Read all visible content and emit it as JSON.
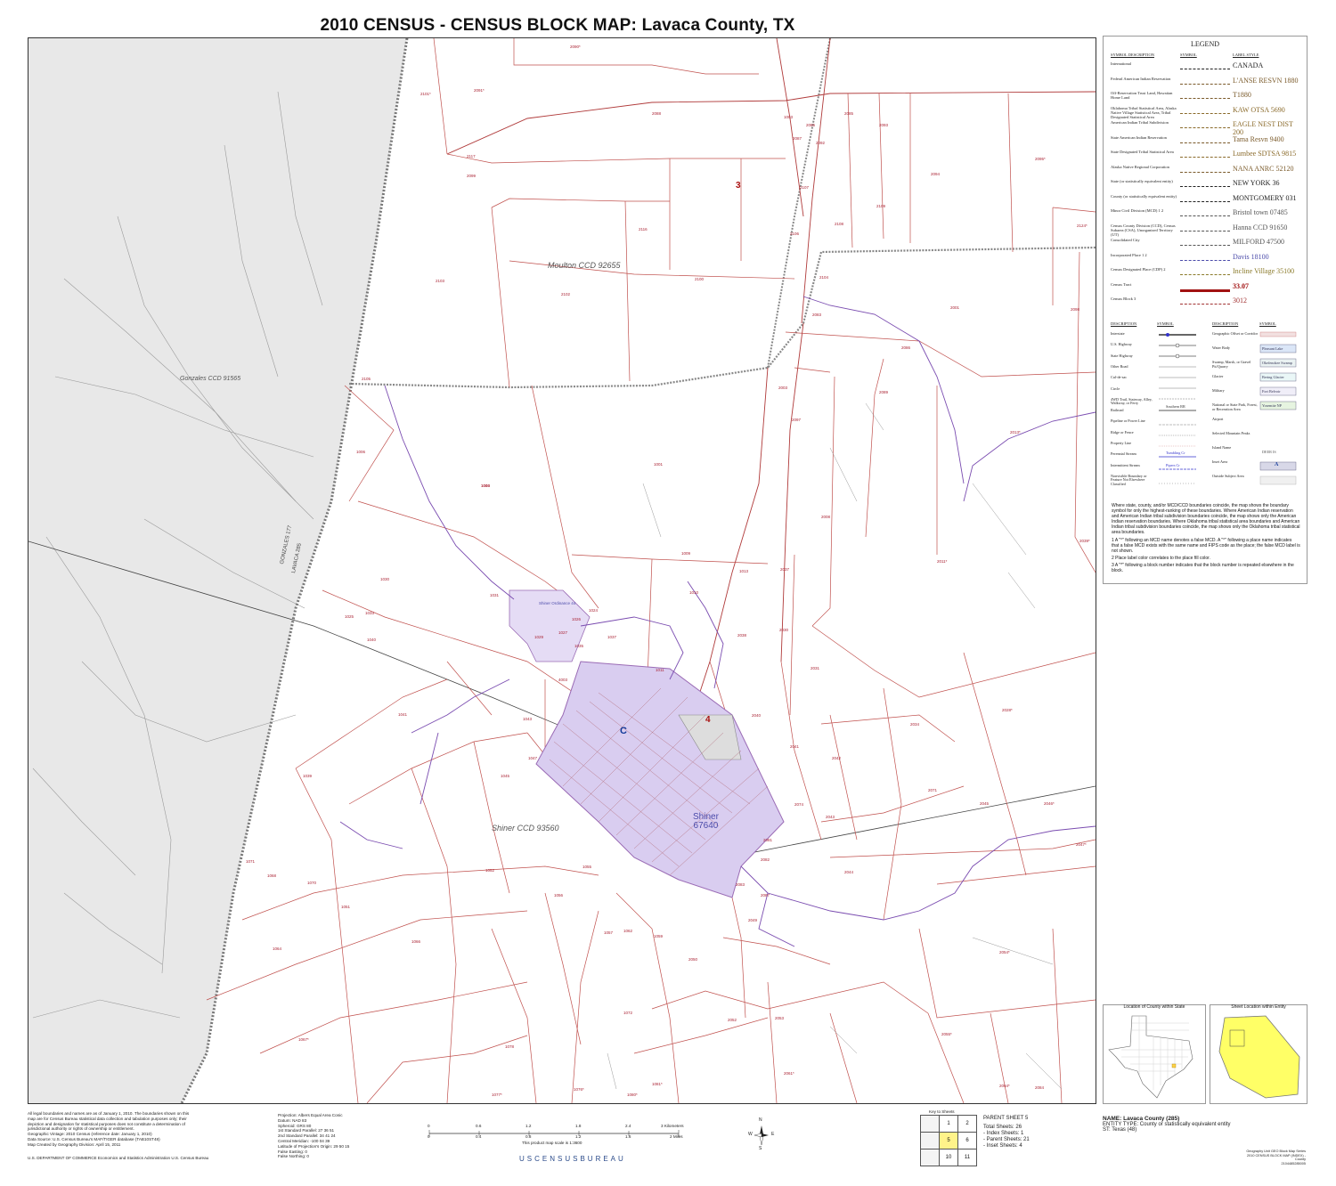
{
  "title": "2010 CENSUS - CENSUS BLOCK MAP:  Lavaca County, TX",
  "map": {
    "ccd_labels": [
      "Moulton CCD 92655",
      "Gonzales CCD 91565",
      "Shiner CCD 93560"
    ],
    "county_line_labels": [
      "GONZALES 177",
      "LAVACA 285"
    ],
    "tract_labels": [
      "3",
      "4"
    ],
    "vtd_label": "C",
    "place_label": [
      "Shiner",
      "67640"
    ],
    "block_labels": [
      "2090*",
      "2101*",
      "2091*",
      "2117",
      "2099",
      "2102",
      "2100",
      "2103",
      "2116",
      "2105",
      "2087",
      "2085",
      "2088",
      "2086",
      "2092",
      "2093",
      "2095*",
      "2094",
      "2107",
      "2106",
      "2109",
      "2108",
      "2104",
      "2124*",
      "2001",
      "2083",
      "2086",
      "2089",
      "2013*",
      "2097",
      "2098",
      "2003",
      "1001",
      "1003",
      "1006",
      "1013",
      "2037",
      "2008",
      "2011*",
      "2039*",
      "1031",
      "1030",
      "1025",
      "1027",
      "1026",
      "1024",
      "1029",
      "1035",
      "1037",
      "1009",
      "1010",
      "2038",
      "2030",
      "2031",
      "1040",
      "1041",
      "1043",
      "4003",
      "1011",
      "1033",
      "1039",
      "1045",
      "1047",
      "2040",
      "2041",
      "2042",
      "2034",
      "2028*",
      "2044",
      "2045",
      "2046*",
      "2047*",
      "2043",
      "2071",
      "2074",
      "2081",
      "2082",
      "1071",
      "1068",
      "1070",
      "1051",
      "1052",
      "1055",
      "1056",
      "1057",
      "1059",
      "1062",
      "1066",
      "1064",
      "1072",
      "1078",
      "1077*",
      "1076*",
      "1081*",
      "1080*",
      "1067*",
      "2083",
      "2087",
      "2049",
      "2050",
      "2052",
      "2053",
      "2054*",
      "2055*",
      "2064*",
      "2061*",
      "2084",
      "1003",
      "1046"
    ],
    "place_area_label": "Shiner Ordinance 44"
  },
  "legend": {
    "title": "LEGEND",
    "col_headers": [
      "SYMBOL DESCRIPTION",
      "SYMBOL",
      "LABEL STYLE"
    ],
    "rows": [
      {
        "desc": "International",
        "label": "CANADA",
        "color": "#222222"
      },
      {
        "desc": "Federal American Indian Reservation",
        "label": "L'ANSE RESVN 1880",
        "color": "#7a5a2a"
      },
      {
        "desc": "Off-Reservation Trust Land, Hawaiian Home Land",
        "label": "T1880",
        "color": "#7a5a2a"
      },
      {
        "desc": "Oklahoma Tribal Statistical Area, Alaska Native Village Statistical Area, Tribal Designated Statistical Area",
        "label": "KAW OTSA 5690",
        "color": "#8a6a2a"
      },
      {
        "desc": "American Indian Tribal Subdivision",
        "label": "EAGLE NEST DIST 200",
        "color": "#8a6a2a"
      },
      {
        "desc": "State American Indian Reservation",
        "label": "Tama Resvn 9400",
        "color": "#7a5a2a"
      },
      {
        "desc": "State Designated Tribal Statistical Area",
        "label": "Lumbee SDTSA 9815",
        "color": "#8a6a2a"
      },
      {
        "desc": "Alaska Native Regional Corporation",
        "label": "NANA ANRC 52120",
        "color": "#7a5a2a"
      },
      {
        "desc": "State (or statistically equivalent entity)",
        "label": "NEW YORK 36",
        "color": "#222222"
      },
      {
        "desc": "County (or statistically equivalent entity)",
        "label": "MONTGOMERY 031",
        "color": "#222222"
      },
      {
        "desc": "Minor Civil Division (MCD) 1 2",
        "label": "Bristol town 07485",
        "color": "#555555"
      },
      {
        "desc": "Census County Division (CCD), Census Subarea (CSA), Unorganized Territory (UT)",
        "label": "Hanna CCD 91650",
        "color": "#555555"
      },
      {
        "desc": "Consolidated City",
        "label": "MILFORD 47500",
        "color": "#555555"
      },
      {
        "desc": "Incorporated Place 1 2",
        "label": "Davis 18100",
        "color": "#4b4baa"
      },
      {
        "desc": "Census Designated Place (CDP) 2",
        "label": "Incline Village 35100",
        "color": "#8a7a2a"
      },
      {
        "desc": "Census Tract",
        "label": "33.07",
        "color": "#a11111"
      },
      {
        "desc": "Census Block 3",
        "label": "3012",
        "color": "#a23333"
      }
    ],
    "features_headers": [
      "DESCRIPTION",
      "SYMBOL",
      "DESCRIPTION",
      "SYMBOL"
    ],
    "features_left": [
      "Interstate",
      "U.S. Highway",
      "State Highway",
      "Other Road",
      "Cul-de-sac",
      "Circle",
      "4WD Trail, Stairway, Alley, Walkway, or Ferry",
      "Railroad",
      "Pipeline or Power Line",
      "Ridge or Fence",
      "Property Line",
      "Perennial Stream",
      "Intermittent Stream",
      "Nonvisible Boundary or Feature Not Elsewhere Classified"
    ],
    "features_right": [
      "Geographic Offset or Corridor",
      "Water Body",
      "Swamp, Marsh, or Gravel Pit/Quarry",
      "Glacier",
      "Military",
      "National or State Park, Forest, or Recreation Area",
      "Airport",
      "Selected Mountain Peaks",
      "Island Name",
      "Inset Area",
      "Outside Subject Area"
    ],
    "feature_samples": [
      "Pleasant Lake",
      "Okefenokee Swamp",
      "Bering Glacier",
      "Fort Belvoir",
      "Yosemite NP",
      "DEER IS",
      "A",
      "Tumbling Cr",
      "Pipers Cr",
      "Southern RR"
    ]
  },
  "notes": {
    "main": "Where state, county, and/or MCD/CCD boundaries coincide, the map shows the boundary symbol for only the highest-ranking of these boundaries. Where American Indian reservation and American Indian tribal subdivision boundaries coincide, the map shows only the American Indian reservation boundaries. Where Oklahoma tribal statistical area boundaries and American Indian tribal subdivision boundaries coincide, the map shows only the Oklahoma tribal statistical area boundaries.",
    "n1": "1  A \"°\" following an MCD name denotes a false MCD. A \"°\" following a place name indicates that a false MCD exists with the same name and FIPS code as the place; the false MCD label is not shown.",
    "n2": "2  Place label color correlates to the place fill color.",
    "n3": "3  A \"*\" following a block number indicates that the block number is repeated elsewhere in the block."
  },
  "insets": {
    "state_title": "Location of County within State",
    "entity_title": "Sheet Location within Entity"
  },
  "footer": {
    "left": [
      "All legal boundaries and names are as of January 1, 2010. The boundaries shown on this",
      "map are for Census Bureau statistical data collection and tabulation purposes only; their",
      "depiction and designation for statistical purposes does not constitute a determination of",
      "jurisdictional authority or rights of ownership or entitlement.",
      "Geographic Vintage: 2010 Census (reference date: January 1, 2010)",
      "Data Source: U.S. Census Bureau's MAF/TIGER database (TAB10ST48)",
      "Map Created by Geography Division: April 15, 2011"
    ],
    "dept": "U.S. DEPARTMENT OF COMMERCE Economics and Statistics Administration U.S. Census Bureau",
    "projection": [
      "Projection: Albers Equal Area Conic",
      "Datum: NAD 83",
      "Spheroid: GRS 80",
      "1st Standard Parallel: 27 36 51",
      "2nd Standard Parallel: 34 41 24",
      "Central Meridian: -100 04 39",
      "Latitude of Projection's Origin: 29 50 15",
      "False Easting: 0",
      "False Northing: 0"
    ],
    "scale_top": [
      "0",
      "0.6",
      "1.2",
      "1.8",
      "2.4",
      "3 Kilometers"
    ],
    "scale_bottom": [
      "0",
      "0.4",
      "0.8",
      "1.2",
      "1.6",
      "2 Miles"
    ],
    "scale_note": "This product map scale is 1:3600",
    "key_title": "Key to Sheets",
    "key_cells": [
      "1",
      "2",
      "5",
      "6",
      "10",
      "11"
    ],
    "parent_sheet": "PARENT SHEET 5",
    "sheet_counts": [
      "Total Sheets: 26",
      "- Index Sheets: 1",
      "- Parent Sheets: 21",
      "- Inset Sheets: 4"
    ],
    "name": "NAME: Lavaca County (285)",
    "entity_type": "ENTITY TYPE: County or statistically equivalent entity",
    "st": "ST: Texas (48)",
    "series": [
      "Geography Unit GEO Block Map Series",
      "2010 CENSUS BLOCK MAP (INDEX) - County",
      "2104485285005"
    ],
    "brand": "USCENSUSBUREAU",
    "compass": [
      "N",
      "W",
      "E",
      "S"
    ]
  },
  "colors": {
    "gray_area": "#e6e6e6",
    "block_line": "#c0504d",
    "tract_line": "#b03a3a",
    "place_fill": "#d9cdf0",
    "stream": "#7a4cb0",
    "road": "#8a8a8a",
    "key_highlight": "#fff38a",
    "inset_yellow": "#ffff66"
  }
}
